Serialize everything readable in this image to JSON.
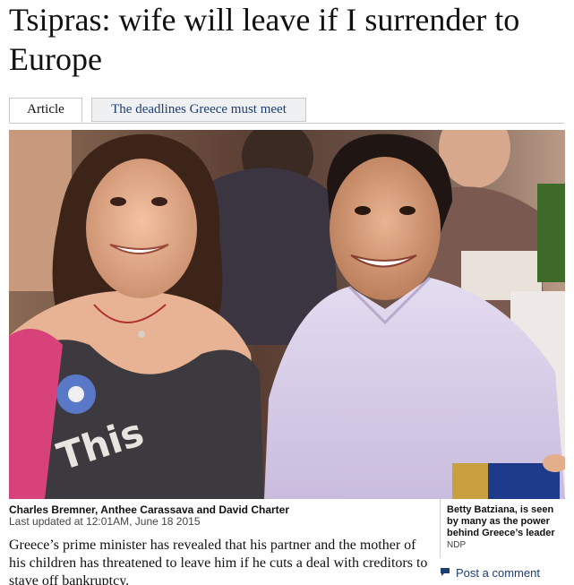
{
  "article": {
    "headline": "Tsipras: wife will leave if I surrender to Europe",
    "tabs": [
      {
        "label": "Article",
        "active": true
      },
      {
        "label": "The deadlines Greece must meet",
        "active": false
      }
    ],
    "byline": "Charles Bremner, Anthee Carassava and David Charter",
    "updated": "Last updated at 12:01AM, June 18 2015",
    "lead": "Greece’s prime minister has revealed that his partner and the mother of his children has threatened to leave him if he cuts a deal with creditors to stave off bankruptcy.",
    "caption": {
      "text": "Betty Batziana, is seen by many as the power behind Greece’s leader",
      "credit": "NDP"
    },
    "comment_label": "Post a comment"
  },
  "colors": {
    "link": "#1d3d73",
    "tab_inactive_bg": "#eef0f2",
    "shirt": "#d9cfe8"
  },
  "icons": {
    "comment": "speech-bubble-icon"
  }
}
